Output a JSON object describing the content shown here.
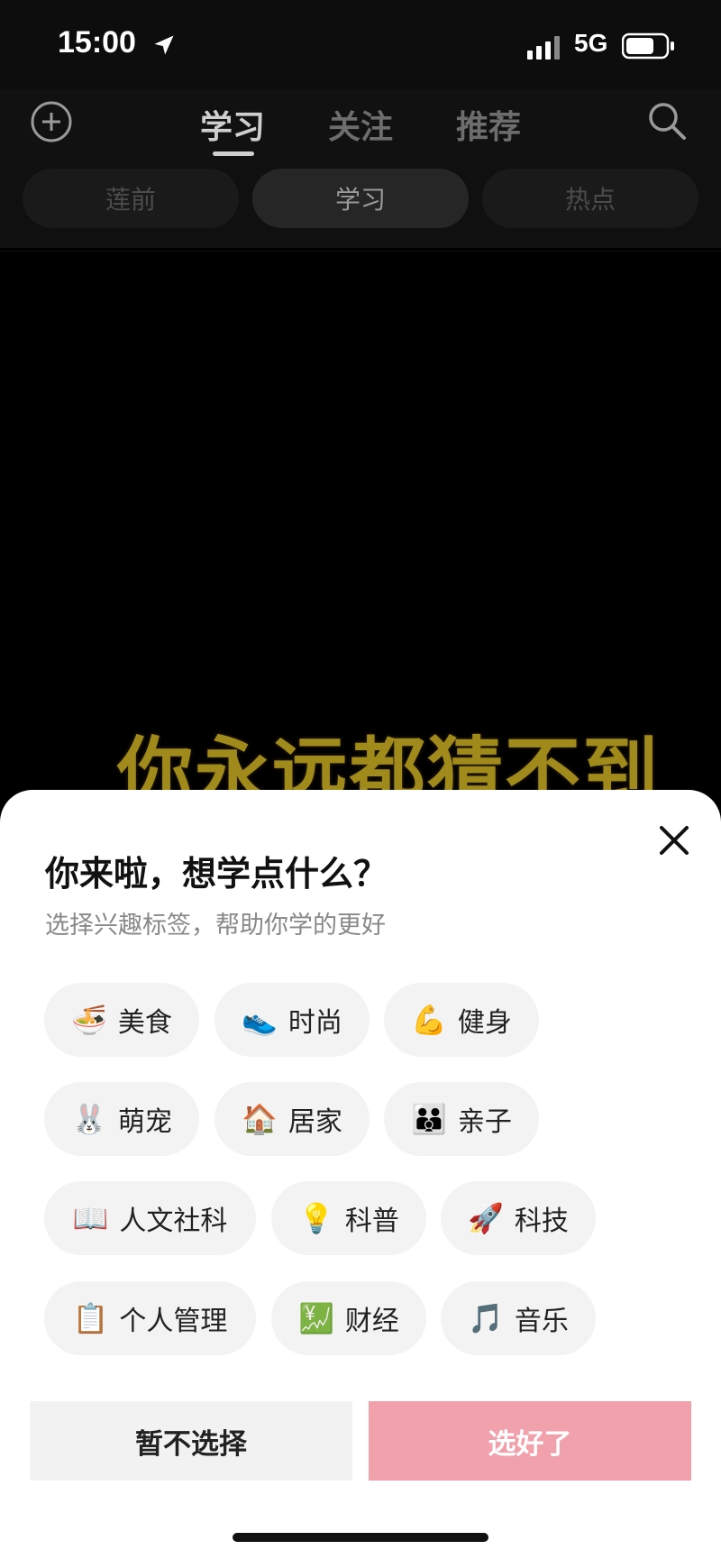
{
  "status_bar": {
    "time": "15:00",
    "network": "5G"
  },
  "top_nav": {
    "tabs": [
      {
        "label": "学习"
      },
      {
        "label": "关注"
      },
      {
        "label": "推荐"
      }
    ]
  },
  "sub_nav": {
    "pills": [
      {
        "label": "莲前"
      },
      {
        "label": "学习"
      },
      {
        "label": "热点"
      }
    ]
  },
  "video": {
    "caption": "你永远都猜不到"
  },
  "sheet": {
    "title": "你来啦，想学点什么？",
    "subtitle": "选择兴趣标签，帮助你学的更好",
    "tags": [
      {
        "emoji": "🍜",
        "label": "美食"
      },
      {
        "emoji": "👟",
        "label": "时尚"
      },
      {
        "emoji": "💪",
        "label": "健身"
      },
      {
        "emoji": "🐰",
        "label": "萌宠"
      },
      {
        "emoji": "🏠",
        "label": "居家"
      },
      {
        "emoji": "👪",
        "label": "亲子"
      },
      {
        "emoji": "📖",
        "label": "人文社科"
      },
      {
        "emoji": "💡",
        "label": "科普"
      },
      {
        "emoji": "🚀",
        "label": "科技"
      },
      {
        "emoji": "📋",
        "label": "个人管理"
      },
      {
        "emoji": "💹",
        "label": "财经"
      },
      {
        "emoji": "🎵",
        "label": "音乐"
      }
    ],
    "skip_label": "暂不选择",
    "done_label": "选好了"
  },
  "colors": {
    "accent": "#f1a1ac",
    "background": "#000000"
  }
}
